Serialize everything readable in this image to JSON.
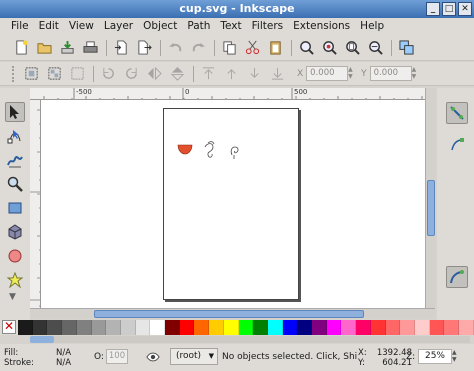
{
  "window": {
    "title": "cup.svg - Inkscape"
  },
  "menu": [
    "File",
    "Edit",
    "View",
    "Layer",
    "Object",
    "Path",
    "Text",
    "Filters",
    "Extensions",
    "Help"
  ],
  "toolbar_coords": {
    "x_label": "X",
    "x_value": "0.000",
    "y_label": "Y",
    "y_value": "0.000"
  },
  "ruler": {
    "top_labels": [
      "-500",
      "0",
      "500"
    ]
  },
  "palette": [
    "#1a1a1a",
    "#333333",
    "#4d4d4d",
    "#666666",
    "#808080",
    "#999999",
    "#b3b3b3",
    "#cccccc",
    "#e6e6e6",
    "#ffffff",
    "#800000",
    "#ff0000",
    "#ff6600",
    "#ffcc00",
    "#ffff00",
    "#00ff00",
    "#008000",
    "#00ffff",
    "#0000ff",
    "#000080",
    "#800080",
    "#ff00ff",
    "#ff66cc",
    "#ff0066",
    "#ff3333",
    "#ff6666",
    "#ff9999",
    "#ffcccc",
    "#ff5555",
    "#ff7777",
    "#ffaaaa"
  ],
  "status": {
    "fill_label": "Fill:",
    "fill_value": "N/A",
    "stroke_label": "Stroke:",
    "stroke_value": "N/A",
    "opacity_label": "O:",
    "opacity_value": "100",
    "layer": "(root)",
    "message": "No objects selected. Click, Shi",
    "x_label": "X:",
    "x_value": "1392.48",
    "y_label": "Y:",
    "y_value": "604.21",
    "zoom_label": "Z:",
    "zoom_value": "25%"
  }
}
